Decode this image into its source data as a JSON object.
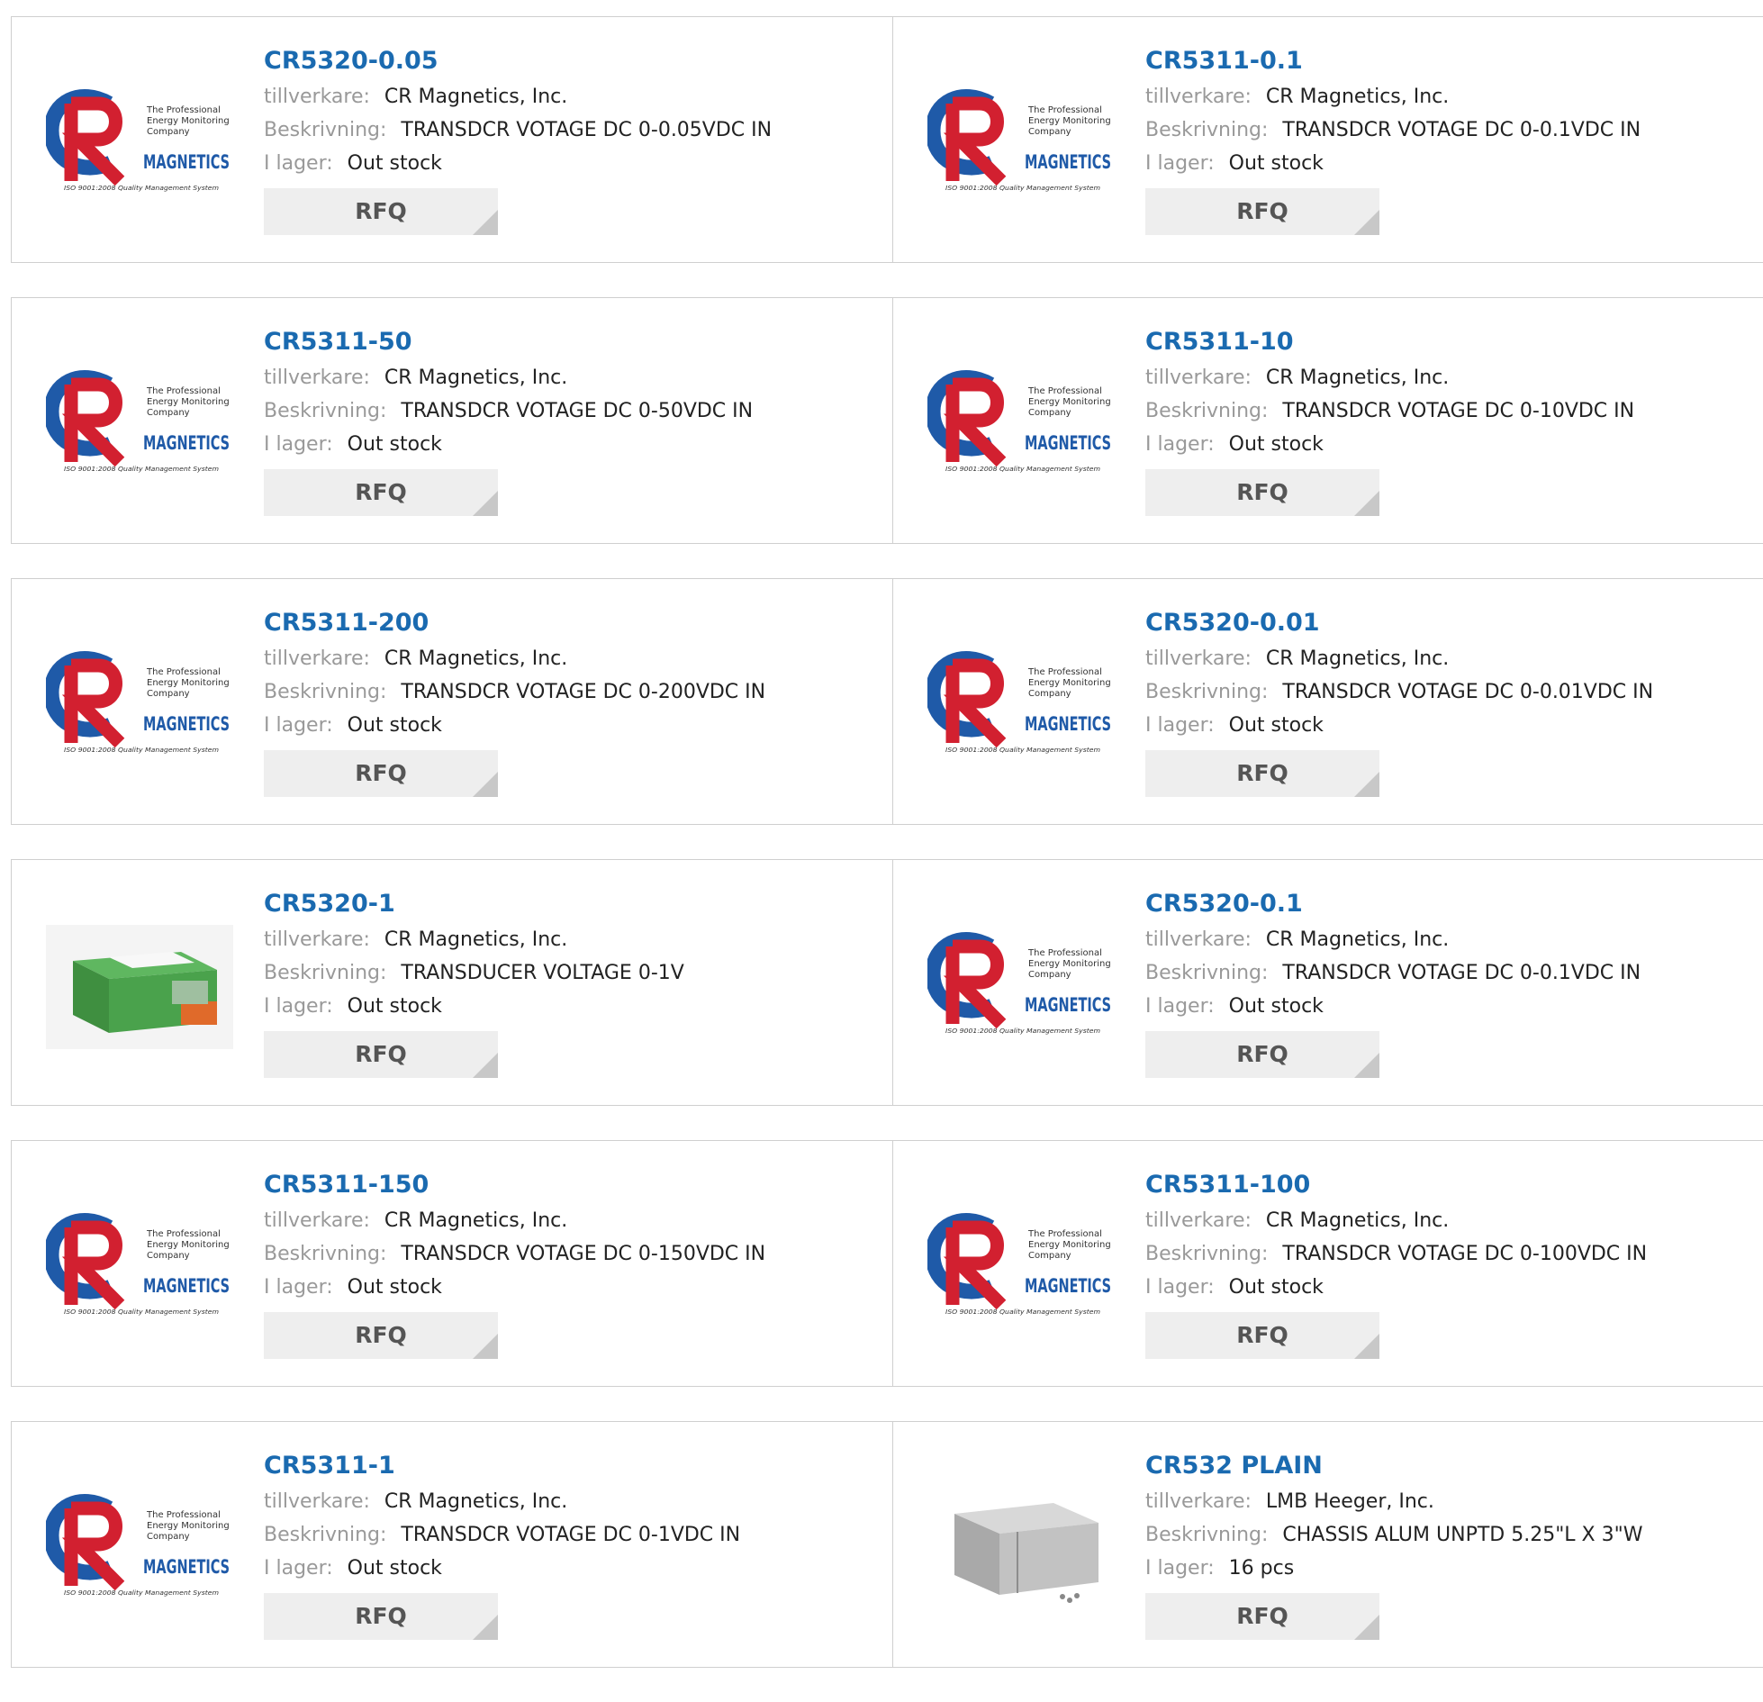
{
  "labels": {
    "manufacturer": "tillverkare:",
    "description": "Beskrivning:",
    "stock": "I lager:",
    "rfq": "RFQ"
  },
  "logo": {
    "tagline_1": "The Professional",
    "tagline_2": "Energy Monitoring",
    "tagline_3": "Company",
    "brand": "MAGNETICS",
    "iso": "ISO 9001:2008 Quality Management System"
  },
  "colors": {
    "title": "#1a6ab0",
    "logo_blue": "#1f5aa8",
    "logo_red": "#d22030"
  },
  "products": [
    {
      "part": "CR5320-0.05",
      "manufacturer": "CR Magnetics, Inc.",
      "description": "TRANSDCR VOTAGE DC 0-0.05VDC IN",
      "stock": "Out stock",
      "image": "cr-magnetics-logo"
    },
    {
      "part": "CR5311-0.1",
      "manufacturer": "CR Magnetics, Inc.",
      "description": "TRANSDCR VOTAGE DC 0-0.1VDC IN",
      "stock": "Out stock",
      "image": "cr-magnetics-logo"
    },
    {
      "part": "CR5311-50",
      "manufacturer": "CR Magnetics, Inc.",
      "description": "TRANSDCR VOTAGE DC 0-50VDC IN",
      "stock": "Out stock",
      "image": "cr-magnetics-logo"
    },
    {
      "part": "CR5311-10",
      "manufacturer": "CR Magnetics, Inc.",
      "description": "TRANSDCR VOTAGE DC 0-10VDC IN",
      "stock": "Out stock",
      "image": "cr-magnetics-logo"
    },
    {
      "part": "CR5311-200",
      "manufacturer": "CR Magnetics, Inc.",
      "description": "TRANSDCR VOTAGE DC 0-200VDC IN",
      "stock": "Out stock",
      "image": "cr-magnetics-logo"
    },
    {
      "part": "CR5320-0.01",
      "manufacturer": "CR Magnetics, Inc.",
      "description": "TRANSDCR VOTAGE DC 0-0.01VDC IN",
      "stock": "Out stock",
      "image": "cr-magnetics-logo"
    },
    {
      "part": "CR5320-1",
      "manufacturer": "CR Magnetics, Inc.",
      "description": "TRANSDUCER VOLTAGE 0-1V",
      "stock": "Out stock",
      "image": "green-transducer-module"
    },
    {
      "part": "CR5320-0.1",
      "manufacturer": "CR Magnetics, Inc.",
      "description": "TRANSDCR VOTAGE DC 0-0.1VDC IN",
      "stock": "Out stock",
      "image": "cr-magnetics-logo"
    },
    {
      "part": "CR5311-150",
      "manufacturer": "CR Magnetics, Inc.",
      "description": "TRANSDCR VOTAGE DC 0-150VDC IN",
      "stock": "Out stock",
      "image": "cr-magnetics-logo"
    },
    {
      "part": "CR5311-100",
      "manufacturer": "CR Magnetics, Inc.",
      "description": "TRANSDCR VOTAGE DC 0-100VDC IN",
      "stock": "Out stock",
      "image": "cr-magnetics-logo"
    },
    {
      "part": "CR5311-1",
      "manufacturer": "CR Magnetics, Inc.",
      "description": "TRANSDCR VOTAGE DC 0-1VDC IN",
      "stock": "Out stock",
      "image": "cr-magnetics-logo"
    },
    {
      "part": "CR532 PLAIN",
      "manufacturer": "LMB Heeger, Inc.",
      "description": "CHASSIS ALUM UNPTD 5.25\"L X 3\"W",
      "stock": "16 pcs",
      "image": "aluminum-chassis"
    }
  ]
}
